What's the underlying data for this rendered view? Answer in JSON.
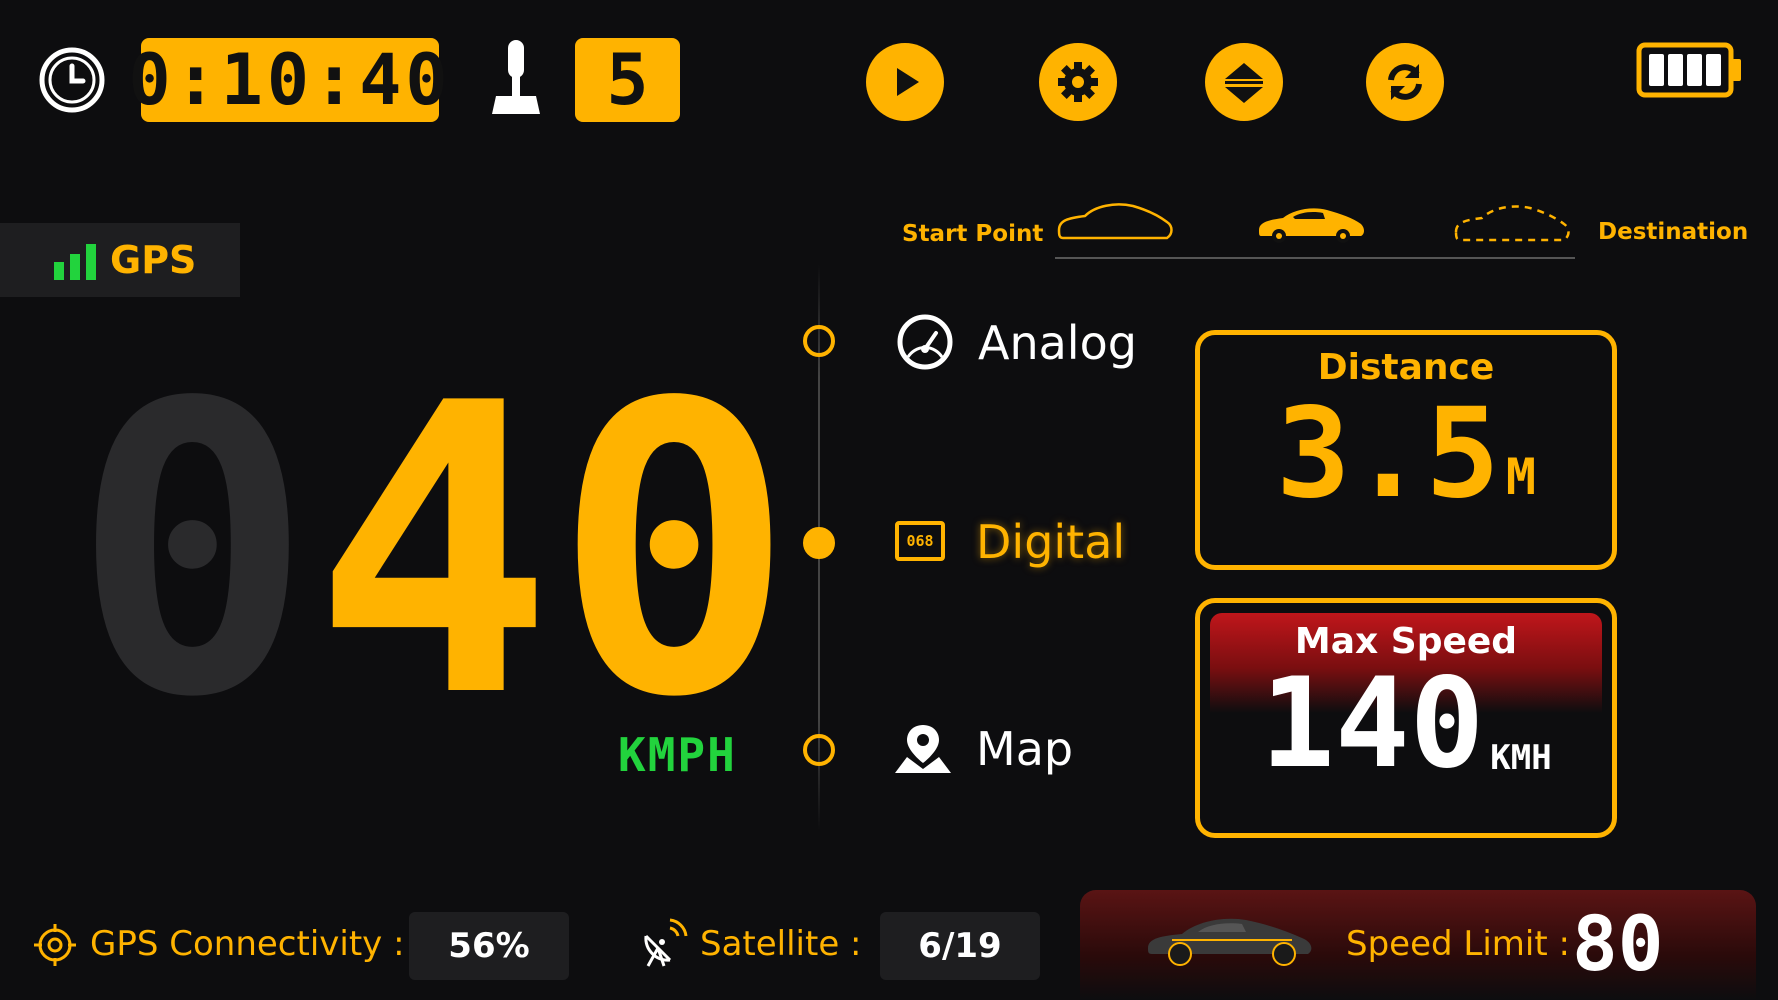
{
  "colors": {
    "accent": "#ffb300",
    "gps_green": "#22d33d",
    "danger_red": "#b3161b",
    "panel": "#1e1e20"
  },
  "top": {
    "timer": "0:10:40",
    "gear": "5",
    "icons": [
      "clock-icon",
      "gear-shift-icon",
      "play-icon",
      "settings-icon",
      "hud-toggle-icon",
      "refresh-icon",
      "battery-icon"
    ]
  },
  "gps": {
    "label": "GPS"
  },
  "route": {
    "start_label": "Start Point",
    "destination_label": "Destination"
  },
  "modes": [
    {
      "label": "Analog",
      "icon": "speedometer-icon",
      "selected": false
    },
    {
      "label": "Digital",
      "icon": "digital-display-icon",
      "icon_text": "068",
      "selected": true
    },
    {
      "label": "Map",
      "icon": "map-pin-icon",
      "selected": false
    }
  ],
  "speed": {
    "d1": "0",
    "d2": "4",
    "d3": "0",
    "unit": "KMPH"
  },
  "distance": {
    "title": "Distance",
    "value": "3.5",
    "unit": "M"
  },
  "max_speed": {
    "title": "Max Speed",
    "value": "140",
    "unit": "KMH"
  },
  "bottom": {
    "gps_conn_label": "GPS Connectivity :",
    "gps_conn_value": "56%",
    "satellite_label": "Satellite :",
    "satellite_value": "6/19",
    "speed_limit_label": "Speed Limit :",
    "speed_limit_value": "80"
  }
}
